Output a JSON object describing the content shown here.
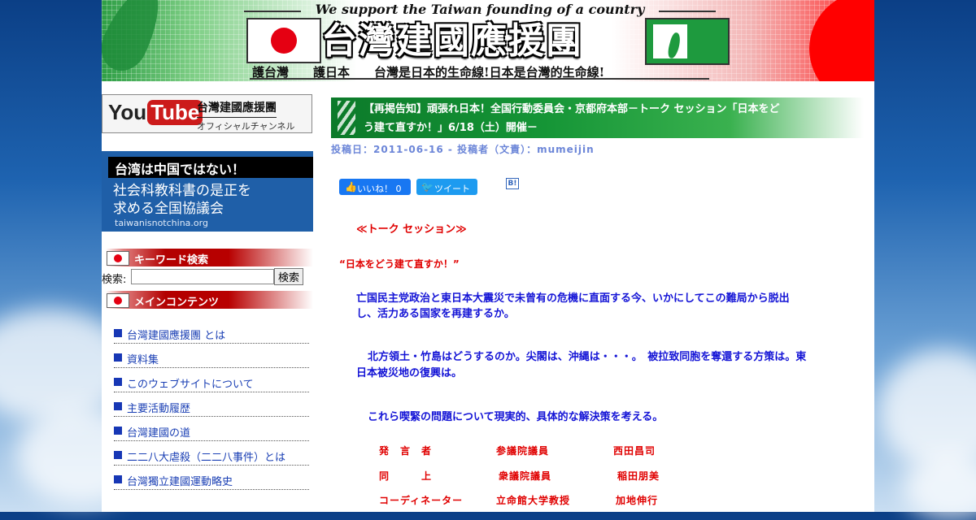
{
  "banner": {
    "slogan": "We support the Taiwan founding of a country",
    "title": "台灣建國應援團",
    "subline": "護台灣　　護日本　　台灣是日本的生命線!日本是台灣的生命線!"
  },
  "sidebar": {
    "youtube": {
      "logo_you": "You",
      "logo_tube": "Tube",
      "channel_name": "台灣建國應援團",
      "channel_sub": "オフィシャルチャンネル"
    },
    "taiwan_not_china": {
      "line1": "台湾は中国ではない！",
      "line2": "社会科教科書の是正を",
      "line3": "求める全国協議会",
      "url": "taiwanisnotchina.org"
    },
    "keyword_heading": "キーワード検索",
    "search": {
      "label": "検索:",
      "value": "",
      "button": "検索"
    },
    "main_heading": "メインコンテンツ",
    "nav": [
      "台灣建國應援團 とは",
      "資料集",
      "このウェブサイトについて",
      "主要活動履歴",
      "台灣建國の道",
      "二二八大虐殺（二二八事件）とは",
      "台灣獨立建國運動略史"
    ]
  },
  "post": {
    "title_line1": "【再掲告知】頑張れ日本！全国行動委員会・京都府本部－トーク セッション「日本をど",
    "title_line2": "う建て直すか！」6/18（土）開催－",
    "meta": "投稿日：2011-06-16 - 投稿者（文責）：mumeijin",
    "share": {
      "like_icon": "thumbs-up-icon",
      "like_label": "いいね！ 0",
      "tweet_label": "ツイート",
      "hatena_label": "B!"
    },
    "session_heading": "≪トーク セッション≫",
    "session_subtitle": "“日本をどう建て直すか！”",
    "para1_line1": "亡国民主党政治と東日本大震災で未曾有の危機に直面する今、いかにしてこの難局から脱出",
    "para1_line2": "し、活力ある国家を再建するか。",
    "para2_line1": "北方領土・竹島はどうするのか。尖閣は、沖縄は・・・。　被拉致同胞を奪還する方策は。東",
    "para2_line2": "日本被災地の復興は。",
    "para3": "これら喫緊の問題について現実的、具体的な解決策を考える。",
    "speakers": [
      {
        "role": "発　言　者",
        "title": "参議院議員",
        "name": "西田昌司"
      },
      {
        "role": "同　　　上",
        "title": "衆議院議員",
        "name": "稲田朋美"
      },
      {
        "role": "コーディネーター",
        "title": "立命館大学教授",
        "name": "加地伸行"
      }
    ]
  }
}
